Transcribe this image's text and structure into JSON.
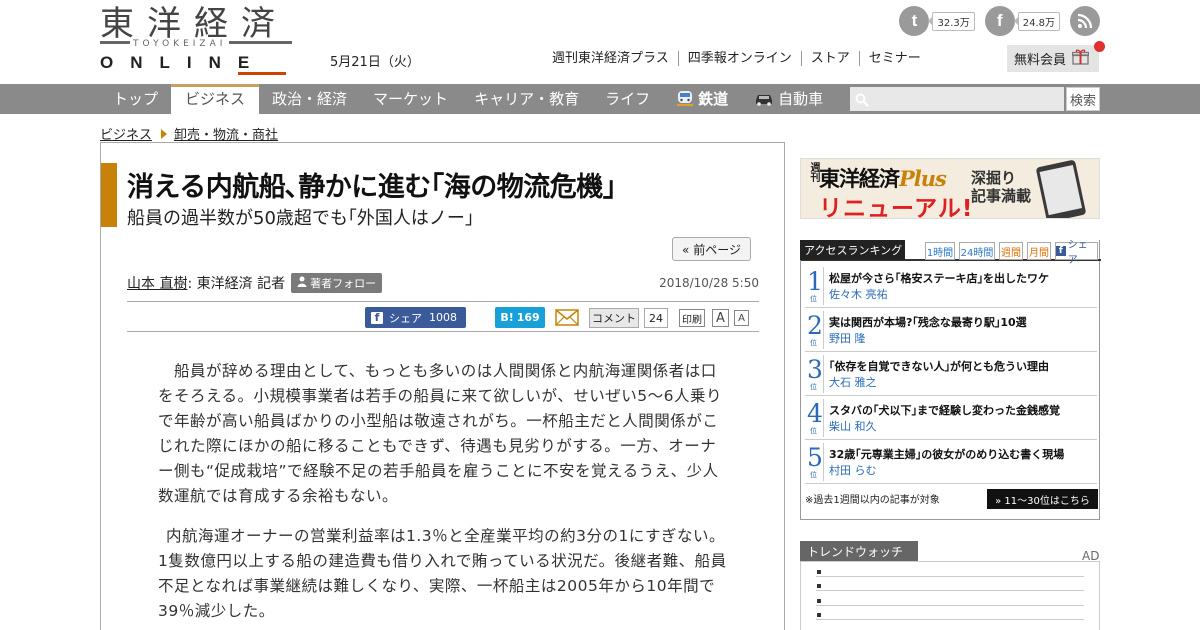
{
  "header": {
    "logo_kanji": "東洋経済",
    "logo_sub": "TOYOKEIZAI",
    "logo_online": "ONLINE",
    "date": "5月21日（火）",
    "social": [
      {
        "icon": "twitter-icon",
        "glyph": "t",
        "count": "32.3万"
      },
      {
        "icon": "facebook-icon",
        "glyph": "f",
        "count": "24.8万"
      },
      {
        "icon": "rss-icon",
        "glyph": "))",
        "count": ""
      }
    ],
    "links": [
      "週刊東洋経済プラス",
      "四季報オンライン",
      "ストア",
      "セミナー"
    ],
    "member_button": "無料会員"
  },
  "nav": {
    "categories": [
      {
        "label": "トップ",
        "active": false
      },
      {
        "label": "ビジネス",
        "active": true
      },
      {
        "label": "政治・経済",
        "active": false
      },
      {
        "label": "マーケット",
        "active": false
      },
      {
        "label": "キャリア・教育",
        "active": false
      },
      {
        "label": "ライフ",
        "active": false
      },
      {
        "label": "鉄道",
        "active": false,
        "icon": "train-icon"
      },
      {
        "label": "自動車",
        "active": false,
        "icon": "car-icon"
      }
    ],
    "search_placeholder": "",
    "search_button": "検索"
  },
  "breadcrumb": [
    "ビジネス",
    "卸売・物流・商社"
  ],
  "article": {
    "title": "消える内航船､静かに進む｢海の物流危機｣",
    "subtitle": "船員の過半数が50歳超でも｢外国人はノー｣",
    "prev_page": "« 前ページ",
    "author": "山本 直樹",
    "author_role": " : 東洋経済 記者",
    "follow": "著者フォロー",
    "date": "2018/10/28 5:50",
    "share": {
      "fb_label": "シェア",
      "fb_count": "1008",
      "hatena_count": "169",
      "comment_label": "コメント",
      "comment_count": "24",
      "print_label": "印刷",
      "font_large": "A",
      "font_small": "A"
    },
    "paragraphs": [
      "船員が辞める理由として、もっとも多いのは人間関係と内航海運関係者は口をそろえる。小規模事業者は若手の船員に来て欲しいが、せいぜい5～6人乗りで年齢が高い船員ばかりの小型船は敬遠されがち。一杯船主だと人間関係がこじれた際にほかの船に移ることもできず、待遇も見劣りがする。一方、オーナー側も“促成栽培”で経験不足の若手船員を雇うことに不安を覚えるうえ、少人数運航では育成する余裕もない。",
      "内航海運オーナーの営業利益率は1.3％と全産業平均の約3分の1にすぎない。1隻数億円以上する船の建造費も借り入れで賄っている状況だ。後継者難、船員不足となれば事業継続は難しくなり、実際、一杯船主は2005年から10年間で39％減少した。"
    ]
  },
  "sidebar": {
    "plus_banner": {
      "small": "週刊",
      "brand": "東洋経済",
      "brand_plus": "Plus",
      "renewal": "リニューアル!",
      "side_text_1": "深掘り",
      "side_text_2": "記事満載"
    },
    "ranking": {
      "title": "アクセスランキング",
      "tabs": [
        "1時間",
        "24時間",
        "週間",
        "月間",
        "シェア"
      ],
      "items": [
        {
          "num": "1",
          "title": "松屋が今さら｢格安ステーキ店｣を出したワケ",
          "author": "佐々木 亮祐"
        },
        {
          "num": "2",
          "title": "実は関西が本場?｢残念な最寄り駅｣10選",
          "author": "野田 隆"
        },
        {
          "num": "3",
          "title": "｢依存を自覚できない人｣が何とも危うい理由",
          "author": "大石 雅之"
        },
        {
          "num": "4",
          "title": "スタバの｢犬以下｣まで経験し変わった金銭感覚",
          "author": "柴山 和久"
        },
        {
          "num": "5",
          "title": "32歳｢元専業主婦｣の彼女がのめり込む書く現場",
          "author": "村田 らむ"
        }
      ],
      "rank_suffix": "位",
      "note": "※過去1週間以内の記事が対象",
      "more": "» 11～30位はこちら"
    },
    "trend_title": "トレンドウォッチ",
    "ad_label": "AD"
  }
}
